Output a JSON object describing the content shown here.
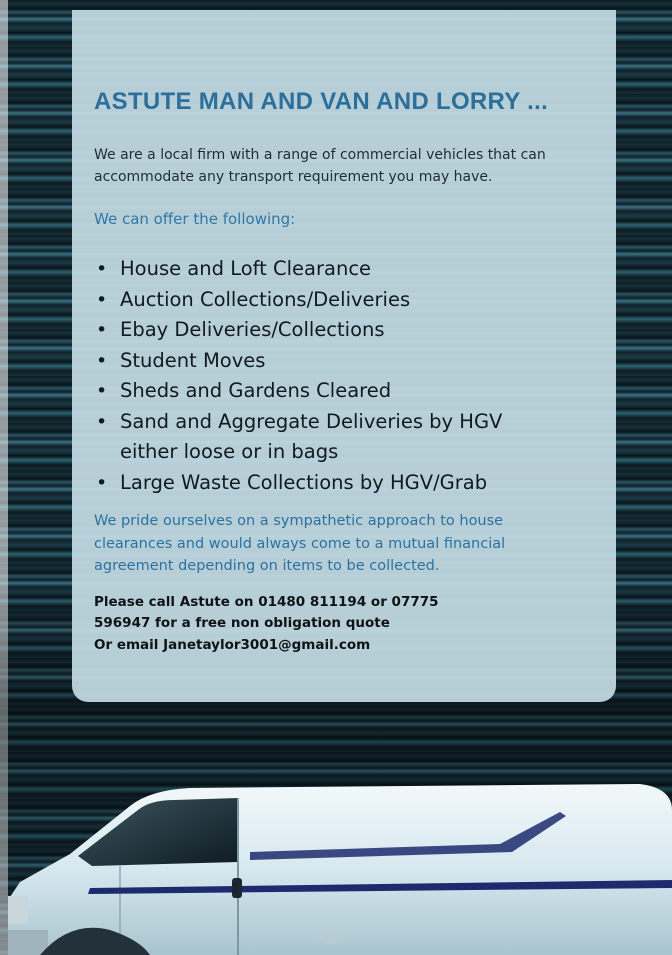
{
  "flyer": {
    "title": "ASTUTE MAN AND VAN AND LORRY ...",
    "intro": "We are a local firm with a range of commercial vehicles that can accommodate any transport requirement you may have.",
    "offer_heading": "We can offer the following:",
    "services": [
      {
        "bullet": "•",
        "label": "House and Loft Clearance"
      },
      {
        "bullet": "•",
        "label": "Auction Collections/Deliveries"
      },
      {
        "bullet": "•",
        "label": "Ebay Deliveries/Collections"
      },
      {
        "bullet": "•",
        "label": "Student Moves"
      },
      {
        "bullet": "•",
        "label": "Sheds and Gardens Cleared"
      },
      {
        "bullet": "•",
        "label": "Sand and Aggregate Deliveries by HGV either loose or in bags"
      },
      {
        "bullet": "•",
        "label": "Large Waste Collections by HGV/Grab"
      }
    ],
    "pride": "We pride ourselves on a sympathetic approach to house clearances and would always come to a mutual financial agreement depending on items to be collected.",
    "contact_line1": "Please call Astute on 01480 811194 or 07775 596947 for a free non obligation quote",
    "contact_line2": "Or email Janetaylor3001@gmail.com"
  },
  "colors": {
    "title": "#2b6f9a",
    "accent_text": "#2f78a5",
    "panel": "#c4dbe4",
    "van_body": "#dfeef3",
    "van_stripe": "#1d2b6e"
  },
  "image": {
    "subject": "white-van-icon"
  }
}
